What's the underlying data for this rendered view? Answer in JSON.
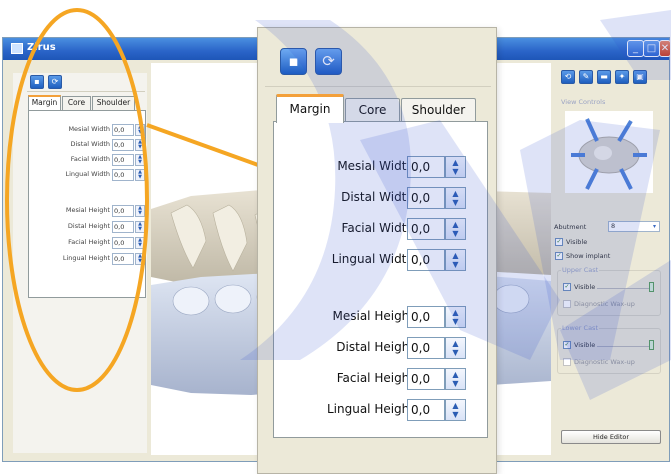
{
  "app_window": {
    "title": "Zirus",
    "window_controls": {
      "minimize": "_",
      "maximize": "□",
      "close": "✕"
    }
  },
  "toolbar": {
    "save_icon": "save-icon",
    "refresh_icon": "refresh-icon"
  },
  "tabs": [
    {
      "label": "Margin",
      "active": true
    },
    {
      "label": "Core",
      "active": false
    },
    {
      "label": "Shoulder",
      "active": false
    }
  ],
  "fields": [
    {
      "label": "Mesial Width",
      "value": "0,0"
    },
    {
      "label": "Distal Width",
      "value": "0,0"
    },
    {
      "label": "Facial Width",
      "value": "0,0"
    },
    {
      "label": "Lingual Width",
      "value": "0,0"
    },
    {
      "label": "Mesial Height",
      "value": "0,0"
    },
    {
      "label": "Distal Height",
      "value": "0,0"
    },
    {
      "label": "Facial Height",
      "value": "0,0"
    },
    {
      "label": "Lingual Height",
      "value": "0,0"
    }
  ],
  "right_panel": {
    "view_controls_label": "View Controls",
    "abutment_label": "Abutment",
    "abutment_value": "8",
    "visible_label": "Visible",
    "show_implant_label": "Show implant",
    "upper_cast_label": "Upper Cast",
    "upper_visible_label": "Visible",
    "upper_waxup_label": "Diagnostic Wax-up",
    "lower_cast_label": "Lower Cast",
    "lower_visible_label": "Visible",
    "lower_waxup_label": "Diagnostic Wax-up",
    "hide_editor_label": "Hide Editor"
  },
  "colors": {
    "highlight_ellipse": "#f5a623",
    "title_bar": "#2a64c8",
    "active_tab_accent": "#f3a03a",
    "watermark": "#2f4fd0"
  }
}
